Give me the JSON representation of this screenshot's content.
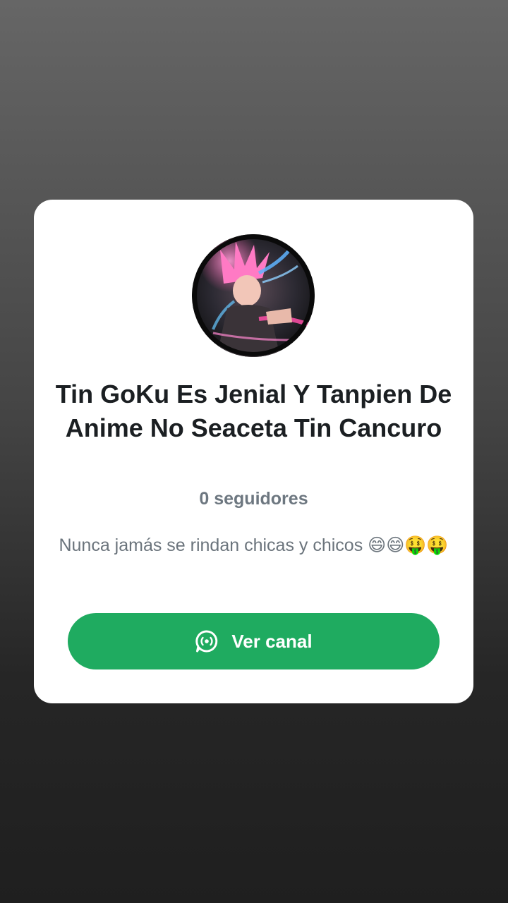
{
  "channel": {
    "name": "Tin GoKu Es Jenial Y Tanpien De Anime No Seaceta Tin Cancuro",
    "followers": "0 seguidores",
    "description": "Nunca jamás se rindan chicas y chicos 😄😄🤑🤑",
    "avatar_icon": "anime-character-avatar"
  },
  "actions": {
    "view_channel_label": "Ver canal",
    "view_channel_icon": "channels-icon"
  },
  "colors": {
    "accent": "#1fab60",
    "card": "#ffffff",
    "title": "#1b1f22",
    "muted": "#6d7780"
  }
}
